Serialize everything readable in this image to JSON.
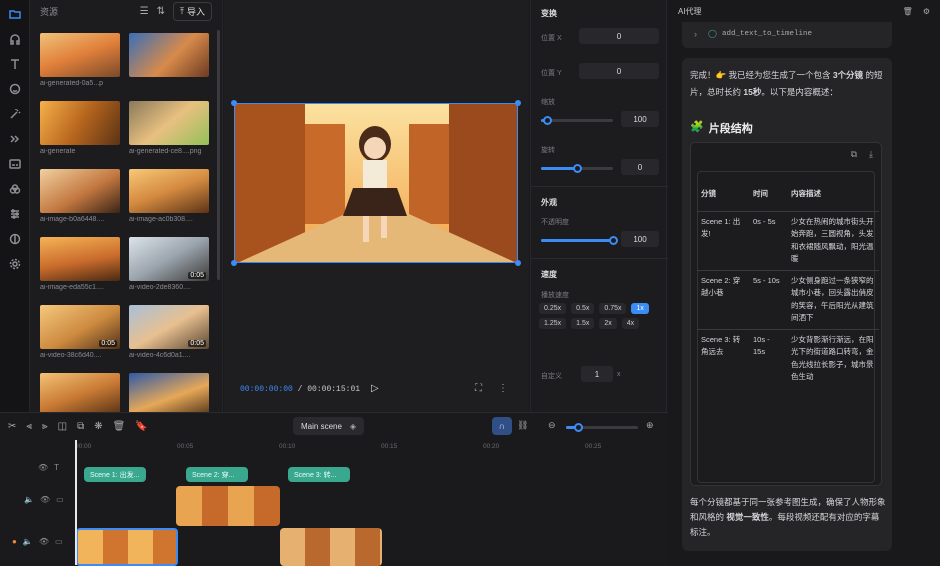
{
  "sidebar": {
    "icons": [
      "folder-icon",
      "headphones-icon",
      "text-icon",
      "sticker-icon",
      "effects-icon",
      "transition-icon",
      "caption-icon",
      "filter-icon",
      "adjust-icon",
      "template-icon",
      "settings-icon"
    ]
  },
  "assets": {
    "title": "资源",
    "import_label": "导入",
    "items": [
      {
        "caption": "ai-generated-0a5...p",
        "duration": ""
      },
      {
        "caption": "",
        "duration": ""
      },
      {
        "caption": "ai-generate",
        "duration": ""
      },
      {
        "caption": "ai-generated-ce8....png",
        "duration": ""
      },
      {
        "caption": "ai-image-b0a6448....",
        "duration": ""
      },
      {
        "caption": "ai-image-ac0b308....",
        "duration": ""
      },
      {
        "caption": "ai-image-eda55c1....",
        "duration": ""
      },
      {
        "caption": "ai-video-2de8360....",
        "duration": "0:05"
      },
      {
        "caption": "ai-video-38c6d40....",
        "duration": "0:05"
      },
      {
        "caption": "ai-video-4c6d0a1....",
        "duration": "0:05"
      },
      {
        "caption": "",
        "duration": ""
      },
      {
        "caption": "",
        "duration": ""
      }
    ]
  },
  "preview": {
    "current_time": "00:00:00:00",
    "separator": "/",
    "total_time": "00:00:15:01"
  },
  "properties": {
    "transform_title": "变换",
    "pos_x_label": "位置 X",
    "pos_x": "0",
    "pos_y_label": "位置 Y",
    "pos_y": "0",
    "scale_label": "缩放",
    "scale": "100",
    "scale_level": 0.08,
    "rotate_label": "旋转",
    "rotate": "0",
    "rotate_level": 0.5,
    "appearance_title": "外观",
    "opacity_label": "不透明度",
    "opacity": "100",
    "opacity_level": 1.0,
    "speed_title": "速度",
    "playback_speed_label": "播放速度",
    "speeds": [
      "0.25x",
      "0.5x",
      "0.75x",
      "1x",
      "1.25x",
      "1.5x",
      "2x",
      "4x"
    ],
    "active_speed": "1x",
    "custom_label": "自定义",
    "custom_value": "1",
    "custom_unit": "x"
  },
  "ai_panel": {
    "title": "AI代理",
    "tool_call": "add_text_to_timeline",
    "intro_prefix": "完成！👉 我已经为您生成了一个包含",
    "intro_bold1": "3个分镜",
    "intro_mid": "的短片，总时长约",
    "intro_bold2": "15秒",
    "intro_suffix": "。以下是内容概述：",
    "section_title": "片段结构",
    "table_headers": [
      "分镜",
      "时间",
      "内容描述"
    ],
    "rows": [
      {
        "scene": "Scene 1: 出发!",
        "time": "0s - 5s",
        "desc": "少女在热闹的城市街头开始奔跑，三圆视角，头发和衣裙随风飘动，阳光温暖"
      },
      {
        "scene": "Scene 2: 穿越小巷",
        "time": "5s - 10s",
        "desc": "少女侧身跑过一条狭窄的城市小巷，回头露出俏皮的笑容，午后阳光从建筑间洒下"
      },
      {
        "scene": "Scene 3: 转角远去",
        "time": "10s - 15s",
        "desc": "少女背影渐行渐远，在阳光下的街道路口转弯，金色光线拉长影子，城市景色生动"
      }
    ],
    "footer_prefix": "每个分镜都基于同一张参考图生成，确保了人物形象和风格的",
    "footer_bold": "视觉一致性",
    "footer_suffix": "。每段视频还配有对应的字幕标注。"
  },
  "timeline": {
    "scene_label": "Main scene",
    "ruler_ticks": [
      "00:00",
      "00:05",
      "00:10",
      "00:15",
      "00:20",
      "00:25"
    ],
    "text_clips": [
      "Scene 1: 出发...",
      "Scene 2: 穿...",
      "Scene 3: 转..."
    ]
  },
  "colors": {
    "accent": "#3d8cf5",
    "text_clip": "#3aa88f"
  }
}
